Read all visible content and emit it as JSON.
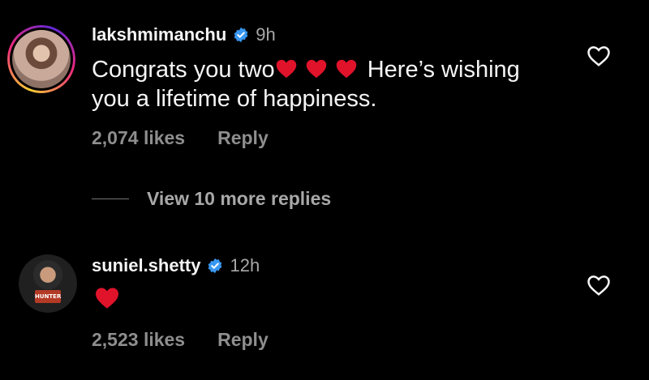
{
  "comments": [
    {
      "username": "lakshmimanchu",
      "time": "9h",
      "text_before": "Congrats you two",
      "text_after": " Here’s wishing you a lifetime of happiness.",
      "heart_count": 3,
      "likes": "2,074 likes",
      "reply": "Reply"
    },
    {
      "username": "suniel.shetty",
      "time": "12h",
      "avatar_badge": "HUNTER",
      "likes": "2,523 likes",
      "reply": "Reply"
    }
  ],
  "view_replies": "View 10 more replies",
  "colors": {
    "background": "#000000",
    "text": "#f5f5f5",
    "muted": "#8e8e8e",
    "verified": "#3897f0",
    "heart": "#e0132b"
  }
}
